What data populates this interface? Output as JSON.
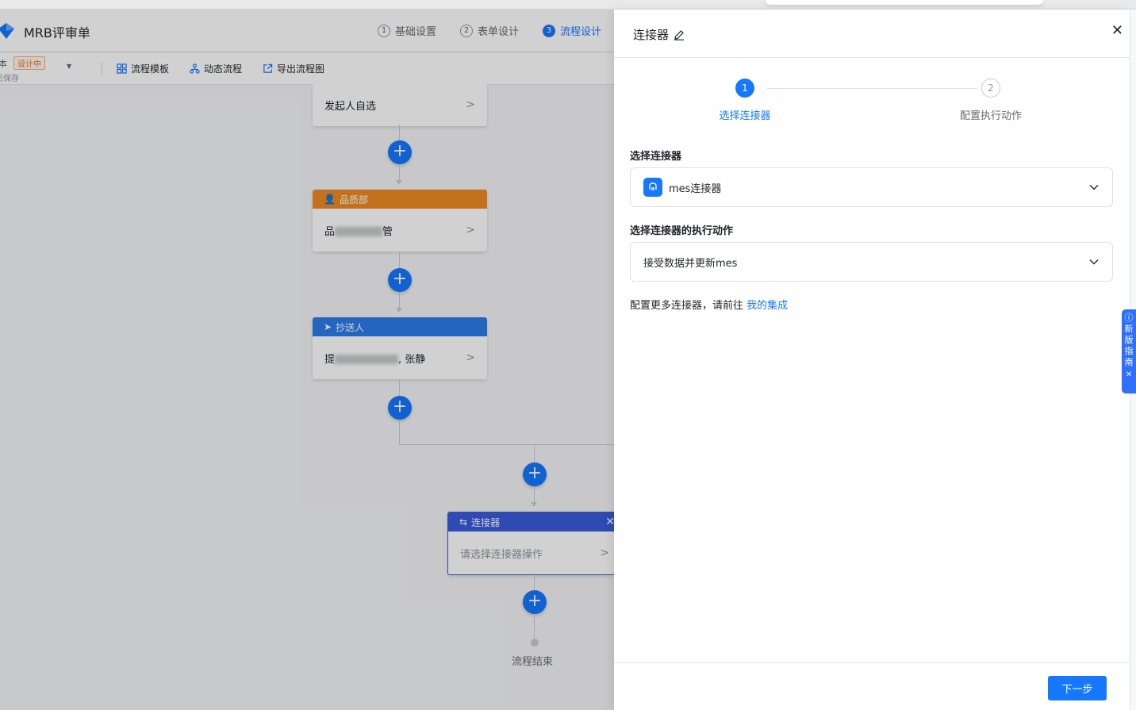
{
  "app": {
    "title": "MRB评审单",
    "steps": [
      {
        "num": "1",
        "label": "基础设置"
      },
      {
        "num": "2",
        "label": "表单设计"
      },
      {
        "num": "3",
        "label": "流程设计"
      }
    ],
    "version_text": "本",
    "version_badge": "设计中",
    "save_status": "已保存",
    "toolbar": {
      "template": "流程模板",
      "dynamic": "动态流程",
      "export": "导出流程图"
    }
  },
  "flow": {
    "initiator_node": {
      "label": "发起人自选"
    },
    "quality_node": {
      "header": "品质部",
      "body_prefix": "品",
      "body_suffix": "管"
    },
    "cc_node": {
      "header": "抄送人",
      "body_prefix": "提",
      "body_suffix": ", 张静"
    },
    "connector_node": {
      "header": "连接器",
      "placeholder": "请选择连接器操作"
    },
    "end_label": "流程结束"
  },
  "drawer": {
    "title": "连接器",
    "wizard": [
      {
        "num": "1",
        "label": "选择连接器"
      },
      {
        "num": "2",
        "label": "配置执行动作"
      }
    ],
    "connector_field": {
      "label": "选择连接器",
      "value": "mes连接器"
    },
    "action_field": {
      "label": "选择连接器的执行动作",
      "value": "接受数据并更新mes"
    },
    "hint_text": "配置更多连接器，请前往",
    "hint_link": "我的集成",
    "next_button": "下一步"
  },
  "guide_tab": {
    "chars": [
      "新",
      "版",
      "指",
      "南"
    ]
  },
  "colors": {
    "primary": "#1677ff",
    "quality_header": "#f08a24",
    "cc_header": "#2b7de9",
    "connector_header": "#3b5bdb"
  }
}
